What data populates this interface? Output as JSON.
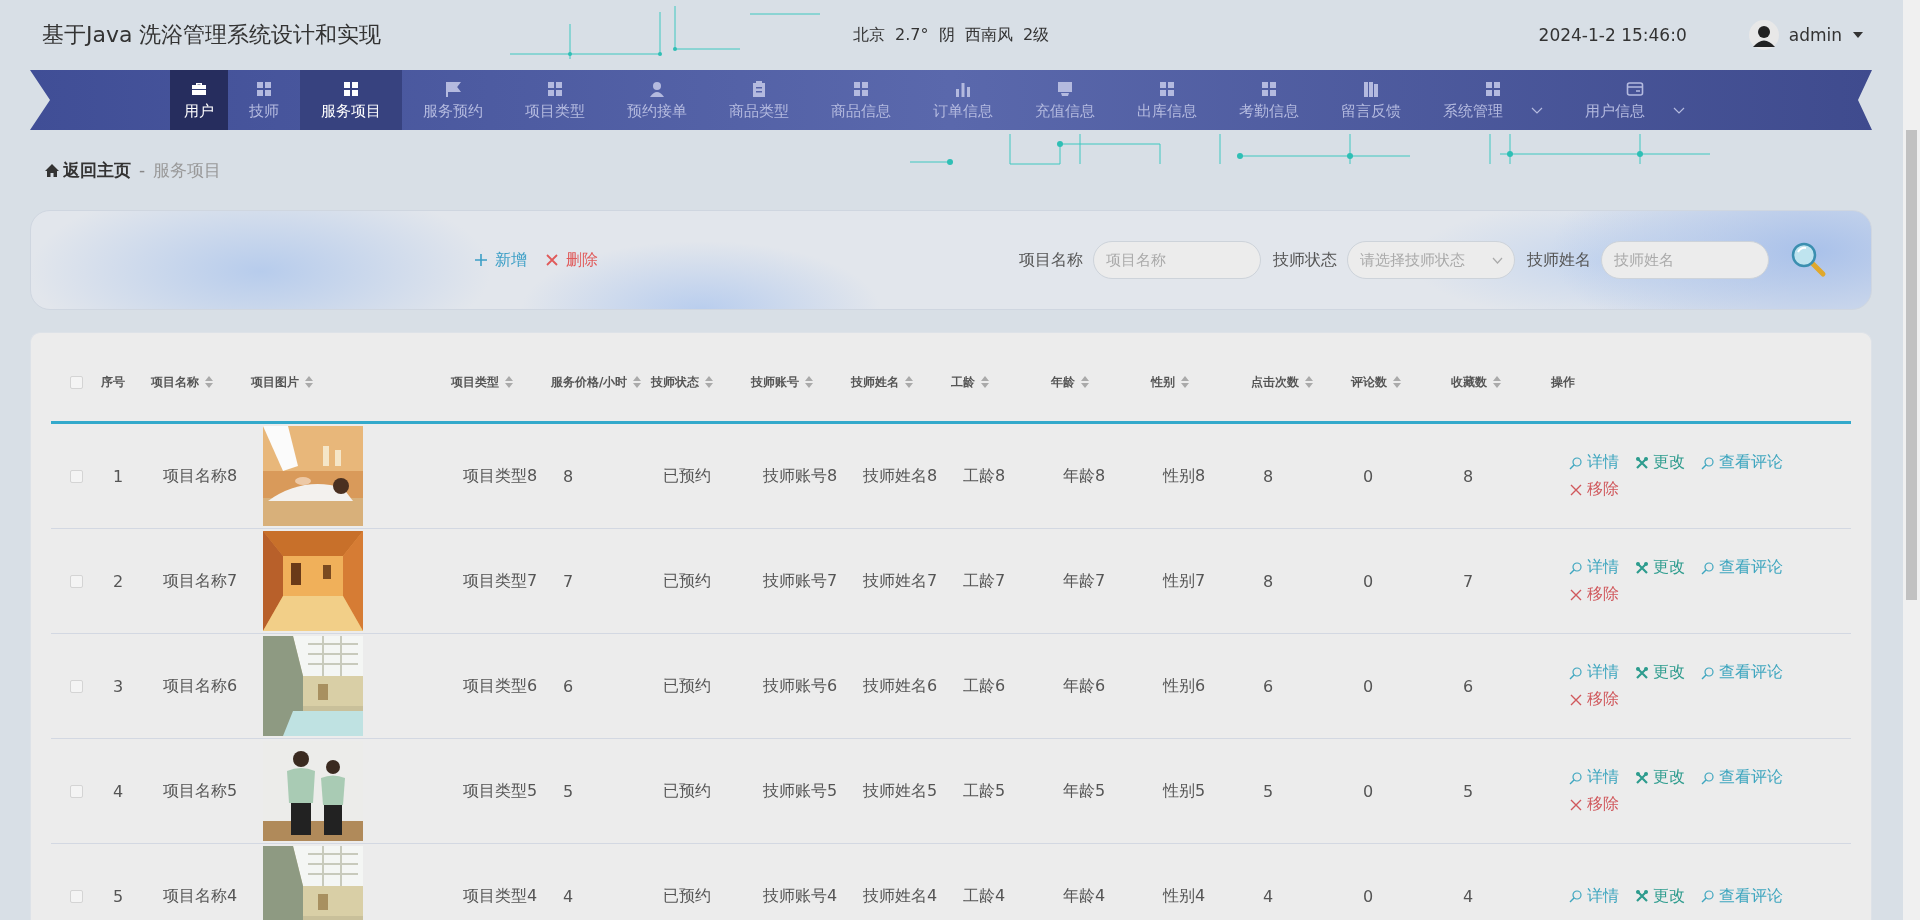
{
  "header": {
    "title": "基于Java 洗浴管理系统设计和实现",
    "weather": "北京  2.7°  阴  西南风  2级",
    "datetime": "2024-1-2 15:46:0",
    "user": "admin"
  },
  "nav": {
    "items": [
      {
        "label": "用户",
        "selected": false,
        "highlighted": true,
        "dropdown": false
      },
      {
        "label": "技师",
        "selected": false,
        "highlighted": false,
        "dropdown": false
      },
      {
        "label": "服务项目",
        "selected": true,
        "highlighted": false,
        "dropdown": false
      },
      {
        "label": "服务预约",
        "selected": false,
        "highlighted": false,
        "dropdown": false
      },
      {
        "label": "项目类型",
        "selected": false,
        "highlighted": false,
        "dropdown": false
      },
      {
        "label": "预约接单",
        "selected": false,
        "highlighted": false,
        "dropdown": false
      },
      {
        "label": "商品类型",
        "selected": false,
        "highlighted": false,
        "dropdown": false
      },
      {
        "label": "商品信息",
        "selected": false,
        "highlighted": false,
        "dropdown": false
      },
      {
        "label": "订单信息",
        "selected": false,
        "highlighted": false,
        "dropdown": false
      },
      {
        "label": "充值信息",
        "selected": false,
        "highlighted": false,
        "dropdown": false
      },
      {
        "label": "出库信息",
        "selected": false,
        "highlighted": false,
        "dropdown": false
      },
      {
        "label": "考勤信息",
        "selected": false,
        "highlighted": false,
        "dropdown": false
      },
      {
        "label": "留言反馈",
        "selected": false,
        "highlighted": false,
        "dropdown": false
      },
      {
        "label": "系统管理",
        "selected": false,
        "highlighted": false,
        "dropdown": true
      },
      {
        "label": "用户信息",
        "selected": false,
        "highlighted": false,
        "dropdown": true
      }
    ]
  },
  "breadcrumb": {
    "home": "返回主页",
    "separator": "-",
    "current": "服务项目"
  },
  "toolbar": {
    "buttons": [
      {
        "label": "新增",
        "kind": "add"
      },
      {
        "label": "删除",
        "kind": "delete"
      }
    ],
    "filters": [
      {
        "label": "项目名称",
        "placeholder": "项目名称",
        "kind": "text"
      },
      {
        "label": "技师状态",
        "placeholder": "请选择技师状态",
        "kind": "select"
      },
      {
        "label": "技师姓名",
        "placeholder": "技师姓名",
        "kind": "text"
      }
    ]
  },
  "table": {
    "select_all": {
      "checked": false
    },
    "columns": [
      {
        "label": "序号",
        "sortable": false,
        "kind": "text"
      },
      {
        "label": "项目名称",
        "sortable": true,
        "kind": "text"
      },
      {
        "label": "项目图片",
        "sortable": true
      },
      {
        "label": "项目类型",
        "sortable": true,
        "kind": "text"
      },
      {
        "label": "服务价格/小时",
        "sortable": true,
        "kind": "text"
      },
      {
        "label": "技师状态",
        "sortable": true,
        "kind": "text"
      },
      {
        "label": "技师账号",
        "sortable": true,
        "kind": "text"
      },
      {
        "label": "技师姓名",
        "sortable": true,
        "kind": "text"
      },
      {
        "label": "工龄",
        "sortable": true,
        "kind": "text"
      },
      {
        "label": "年龄",
        "sortable": true,
        "kind": "text"
      },
      {
        "label": "性别",
        "sortable": true,
        "kind": "text"
      },
      {
        "label": "点击次数",
        "sortable": true,
        "kind": "text"
      },
      {
        "label": "评论数",
        "sortable": true,
        "kind": "text"
      },
      {
        "label": "收藏数",
        "sortable": true,
        "kind": "text"
      },
      {
        "label": "操作",
        "sortable": false,
        "kind": "actions"
      }
    ],
    "rows": [
      {
        "checked": false,
        "cells": [
          "1",
          "项目名称8",
          {
            "kind": "picture"
          },
          "项目类型8",
          "8",
          "已预约",
          "技师账号8",
          "技师姓名8",
          "工龄8",
          "年龄8",
          "性别8",
          "8",
          "0",
          "8"
        ],
        "actions": [
          {
            "label": "详情",
            "kind": "detail"
          },
          {
            "label": "更改",
            "kind": "edit"
          },
          {
            "label": "查看评论",
            "kind": "comments"
          },
          {
            "label": "移除",
            "kind": "remove"
          }
        ]
      },
      {
        "checked": false,
        "cells": [
          "2",
          "项目名称7",
          {
            "kind": "picture"
          },
          "项目类型7",
          "7",
          "已预约",
          "技师账号7",
          "技师姓名7",
          "工龄7",
          "年龄7",
          "性别7",
          "8",
          "0",
          "7"
        ],
        "actions": [
          {
            "label": "详情",
            "kind": "detail"
          },
          {
            "label": "更改",
            "kind": "edit"
          },
          {
            "label": "查看评论",
            "kind": "comments"
          },
          {
            "label": "移除",
            "kind": "remove"
          }
        ]
      },
      {
        "checked": false,
        "cells": [
          "3",
          "项目名称6",
          {
            "kind": "picture"
          },
          "项目类型6",
          "6",
          "已预约",
          "技师账号6",
          "技师姓名6",
          "工龄6",
          "年龄6",
          "性别6",
          "6",
          "0",
          "6"
        ],
        "actions": [
          {
            "label": "详情",
            "kind": "detail"
          },
          {
            "label": "更改",
            "kind": "edit"
          },
          {
            "label": "查看评论",
            "kind": "comments"
          },
          {
            "label": "移除",
            "kind": "remove"
          }
        ]
      },
      {
        "checked": false,
        "cells": [
          "4",
          "项目名称5",
          {
            "kind": "picture"
          },
          "项目类型5",
          "5",
          "已预约",
          "技师账号5",
          "技师姓名5",
          "工龄5",
          "年龄5",
          "性别5",
          "5",
          "0",
          "5"
        ],
        "actions": [
          {
            "label": "详情",
            "kind": "detail"
          },
          {
            "label": "更改",
            "kind": "edit"
          },
          {
            "label": "查看评论",
            "kind": "comments"
          },
          {
            "label": "移除",
            "kind": "remove"
          }
        ]
      },
      {
        "checked": false,
        "cells": [
          "5",
          "项目名称4",
          {
            "kind": "picture"
          },
          "项目类型4",
          "4",
          "已预约",
          "技师账号4",
          "技师姓名4",
          "工龄4",
          "年龄4",
          "性别4",
          "4",
          "0",
          "4"
        ],
        "actions": [
          {
            "label": "详情",
            "kind": "detail"
          },
          {
            "label": "更改",
            "kind": "edit"
          },
          {
            "label": "查看评论",
            "kind": "comments"
          }
        ]
      }
    ]
  }
}
